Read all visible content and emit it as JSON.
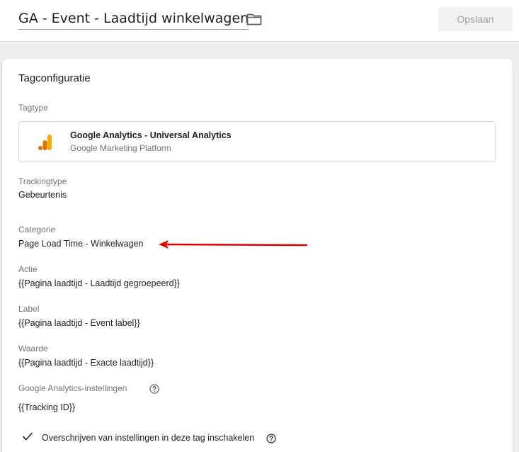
{
  "header": {
    "title": "GA - Event - Laadtijd winkelwagen",
    "save_label": "Opslaan"
  },
  "card": {
    "title": "Tagconfiguratie",
    "tagtype_label": "Tagtype",
    "tagtype_name": "Google Analytics - Universal Analytics",
    "tagtype_platform": "Google Marketing Platform",
    "trackingtype_label": "Trackingtype",
    "trackingtype_value": "Gebeurtenis",
    "category_label": "Categorie",
    "category_value": "Page Load Time - Winkelwagen",
    "action_label": "Actie",
    "action_value": "{{Pagina laadtijd - Laadtijd gegroepeerd}}",
    "label_label": "Label",
    "label_value": "{{Pagina laadtijd - Event label}}",
    "value_label": "Waarde",
    "value_value": "{{Pagina laadtijd - Exacte laadtijd}}",
    "ga_settings_label": "Google Analytics-instellingen",
    "ga_settings_value": "{{Tracking ID}}",
    "override_label": "Overschrijven van instellingen in deze tag inschakelen"
  },
  "icons": {
    "folder": "folder-icon",
    "google-analytics": "google-analytics-icon",
    "help": "help-circle-icon",
    "check": "check-icon",
    "annotation-arrow": "red-arrow"
  },
  "colors": {
    "ga_orange": "#f9ab00",
    "ga_dark_orange": "#e37400",
    "annotation_red": "#e00000",
    "save_disabled_bg": "#f1f1f1"
  }
}
